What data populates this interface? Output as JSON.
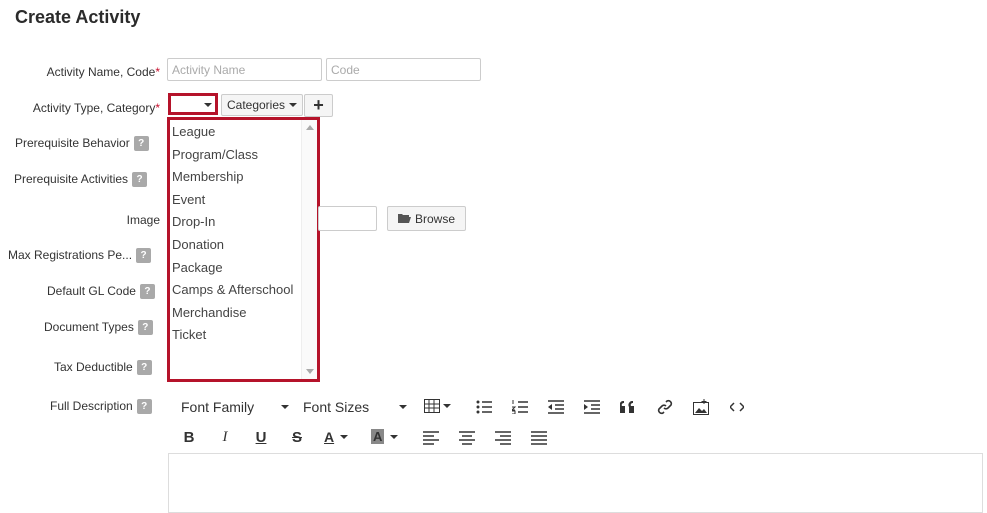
{
  "page": {
    "title": "Create Activity"
  },
  "fields": {
    "name_code": {
      "label": "Activity Name, Code",
      "required_mark": "*",
      "name_placeholder": "Activity Name",
      "code_placeholder": "Code"
    },
    "type_category": {
      "label": "Activity Type, Category",
      "required_mark": "*",
      "categories_label": "Categories",
      "add_label": "+"
    },
    "prerequisite_behavior": {
      "label": "Prerequisite Behavior",
      "help": "?"
    },
    "prerequisite_activities": {
      "label": "Prerequisite Activities",
      "help": "?"
    },
    "image": {
      "label": "Image",
      "browse_label": "Browse"
    },
    "max_registrations": {
      "label": "Max Registrations Pe...",
      "help": "?"
    },
    "default_gl_code": {
      "label": "Default GL Code",
      "help": "?"
    },
    "document_types": {
      "label": "Document Types",
      "help": "?"
    },
    "tax_deductible": {
      "label": "Tax Deductible",
      "help": "?"
    },
    "full_description": {
      "label": "Full Description",
      "help": "?"
    }
  },
  "activity_type_options": [
    "League",
    "Program/Class",
    "Membership",
    "Event",
    "Drop-In",
    "Donation",
    "Package",
    "Camps & Afterschool",
    "Merchandise",
    "Ticket"
  ],
  "editor": {
    "font_family": "Font Family",
    "font_sizes": "Font Sizes",
    "bold": "B",
    "italic": "I",
    "underline": "U",
    "strike": "S",
    "font_color": "A",
    "bg_color": "A"
  },
  "colors": {
    "highlight": "#b5132a",
    "required": "#c8102e"
  }
}
